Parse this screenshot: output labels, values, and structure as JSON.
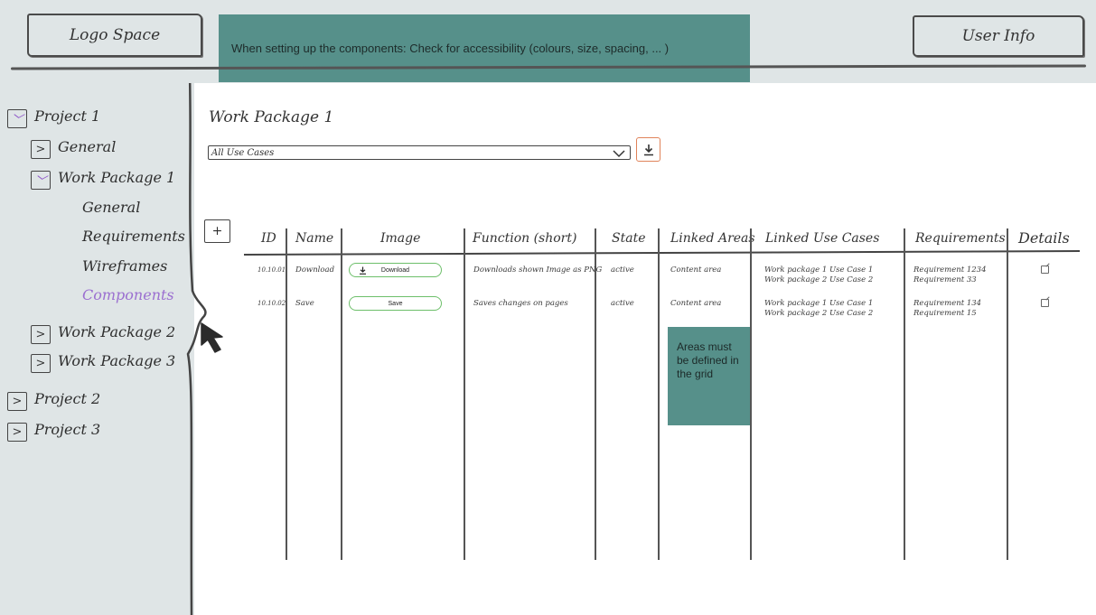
{
  "header": {
    "logo": "Logo Space",
    "user": "User Info",
    "banner": "When setting up the components: Check for accessibility (colours, size, spacing, ... )"
  },
  "sidebar": {
    "items": [
      {
        "label": "Project 1",
        "toggle": "open"
      },
      {
        "label": "General",
        "toggle": "closed"
      },
      {
        "label": "Work Package 1",
        "toggle": "open"
      },
      {
        "label": "General"
      },
      {
        "label": "Requirements"
      },
      {
        "label": "Wireframes"
      },
      {
        "label": "Components",
        "active": true
      },
      {
        "label": "Work Package 2",
        "toggle": "closed"
      },
      {
        "label": "Work Package 3",
        "toggle": "closed"
      },
      {
        "label": "Project 2",
        "toggle": "closed"
      },
      {
        "label": "Project 3",
        "toggle": "closed"
      }
    ]
  },
  "main": {
    "title": "Work Package 1",
    "filter_value": "All Use Cases",
    "add_label": "+"
  },
  "table": {
    "columns": [
      "ID",
      "Name",
      "Image",
      "Function (short)",
      "State",
      "Linked Areas",
      "Linked Use Cases",
      "Requirements",
      "Details"
    ],
    "rows": [
      {
        "id": "10.10.01",
        "name": "Download",
        "image_label": "Download",
        "function": "Downloads shown Image as PNG",
        "state": "active",
        "areas": "Content area",
        "use_cases": [
          "Work package 1 Use Case 1",
          "Work package 2 Use Case 2"
        ],
        "requirements": [
          "Requirement 1234",
          "Requirement 33"
        ]
      },
      {
        "id": "10.10.02",
        "name": "Save",
        "image_label": "Save",
        "function": "Saves changes on pages",
        "state": "active",
        "areas": "Content area",
        "use_cases": [
          "Work package 1 Use Case 1",
          "Work package 2 Use Case 2"
        ],
        "requirements": [
          "Requirement 134",
          "Requirement 15"
        ]
      }
    ]
  },
  "note": "Areas must be defined in the grid",
  "colors": {
    "header_bg": "#dfe5e6",
    "banner_bg": "#56908a",
    "active_purple": "#9b6fd0",
    "download_border": "#e0835a",
    "pill_border": "#6dbf6a"
  }
}
